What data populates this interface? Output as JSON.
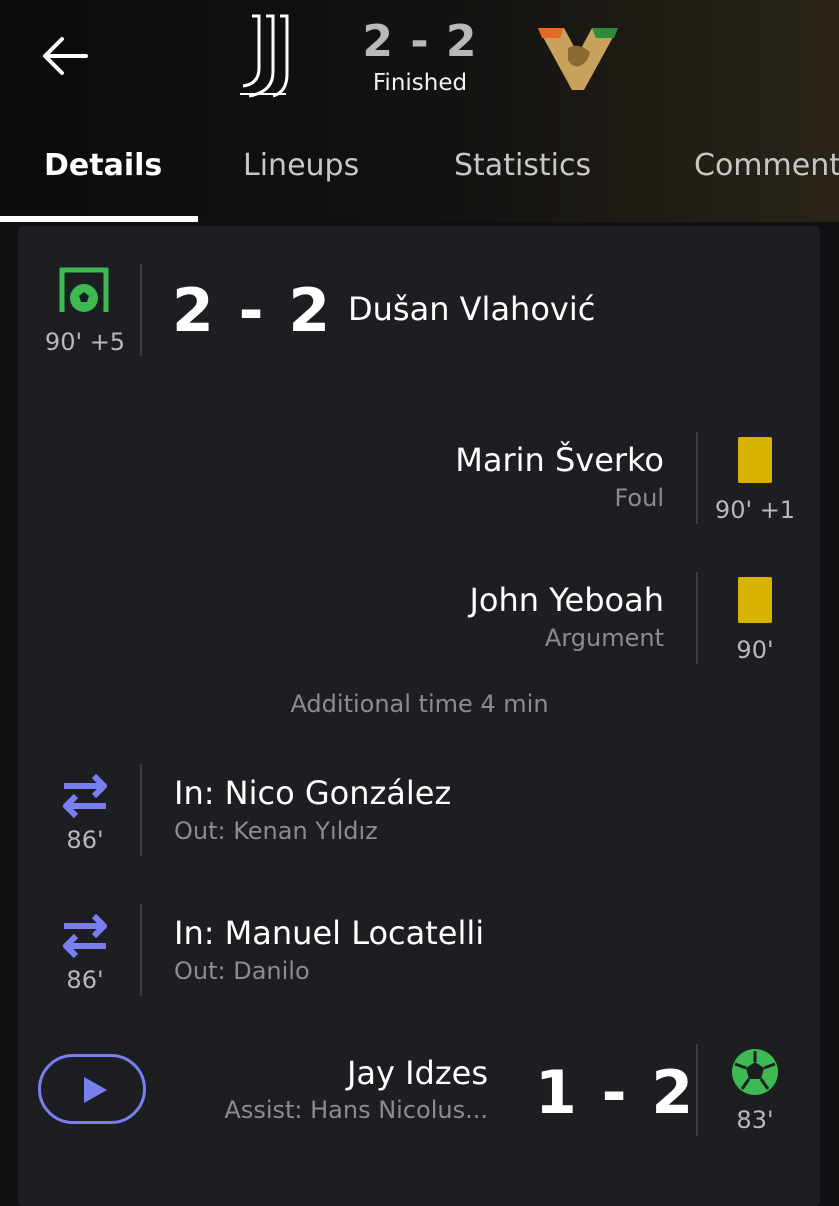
{
  "match": {
    "score": "2 - 2",
    "status": "Finished",
    "home_logo": "juventus-logo",
    "away_logo": "venezia-logo"
  },
  "tabs": [
    {
      "label": "Details",
      "active": true
    },
    {
      "label": "Lineups",
      "active": false
    },
    {
      "label": "Statistics",
      "active": false
    },
    {
      "label": "Comment",
      "active": false
    }
  ],
  "events": {
    "goal1": {
      "minute": "90' +5",
      "score": "2 - 2",
      "player": "Dušan Vlahović",
      "icon": "goal-net-icon"
    },
    "card1": {
      "player": "Marin Šverko",
      "reason": "Foul",
      "minute": "90' +1",
      "icon": "yellow-card-icon"
    },
    "card2": {
      "player": "John Yeboah",
      "reason": "Argument",
      "minute": "90'",
      "icon": "yellow-card-icon"
    },
    "additional_time": "Additional time 4 min",
    "sub1": {
      "in": "In: Nico González",
      "out": "Out: Kenan Yıldız",
      "minute": "86'",
      "icon": "substitution-icon"
    },
    "sub2": {
      "in": "In: Manuel Locatelli",
      "out": "Out: Danilo",
      "minute": "86'",
      "icon": "substitution-icon"
    },
    "goal2": {
      "player": "Jay Idzes",
      "assist": "Assist: Hans Nicolus...",
      "score": "1 - 2",
      "minute": "83'",
      "icon": "ball-icon"
    }
  },
  "colors": {
    "goal_green": "#3dbb52",
    "card_yellow": "#d7b200",
    "sub_purple": "#7a7ff0"
  }
}
